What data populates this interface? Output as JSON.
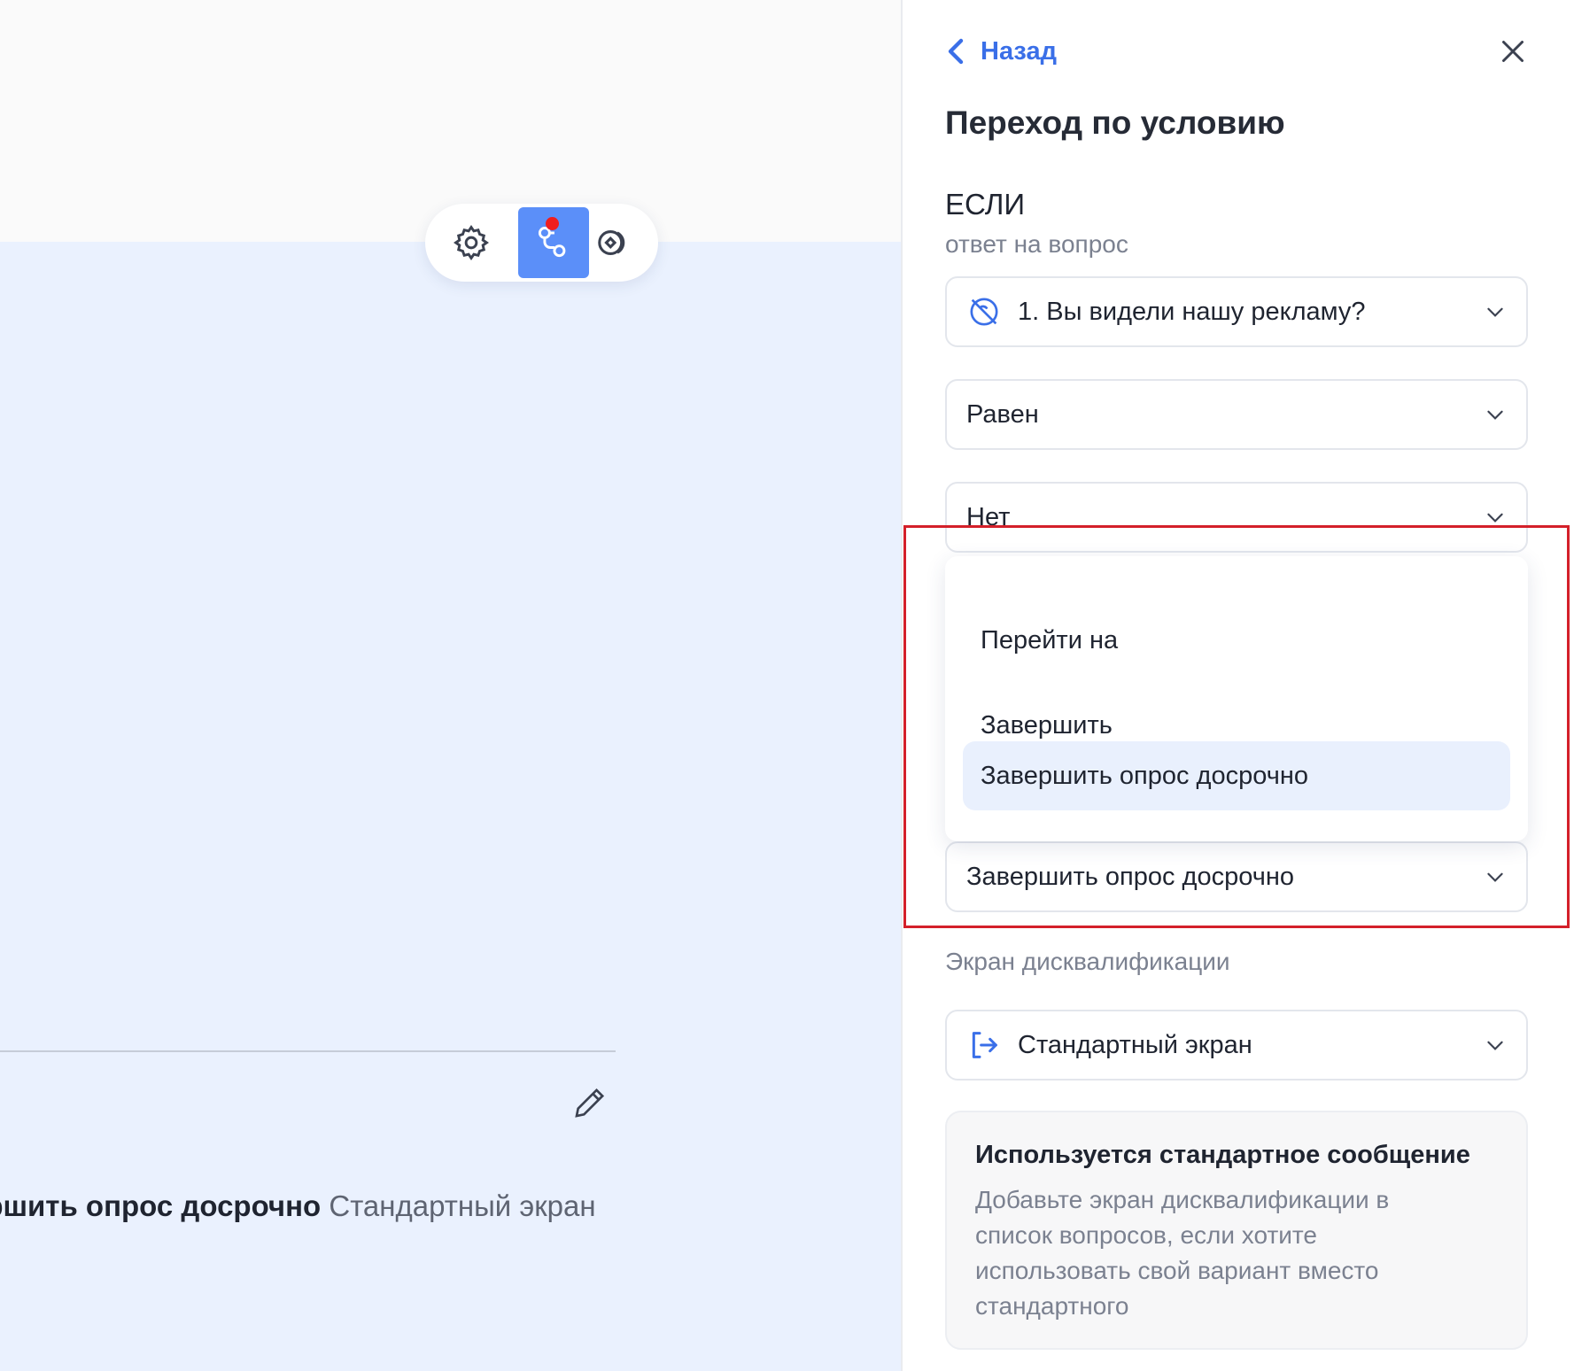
{
  "canvas": {
    "summary_bold": "ершить опрос досрочно",
    "summary_rest": "Стандартный экран"
  },
  "toolbar": {
    "buttons": [
      "gear-icon",
      "branch-icon",
      "eye-icon"
    ],
    "active": "branch-icon",
    "accent_color": "#5b8ff9",
    "badge_color": "#f01e1e"
  },
  "panel": {
    "back_label": "Назад",
    "title": "Переход по условию",
    "if_label": "ЕСЛИ",
    "if_sub": "ответ на вопрос",
    "question_select": "1. Вы видели нашу рекламу?",
    "operator_select": "Равен",
    "answer_select": "Нет",
    "action_menu": {
      "items": [
        "Перейти на",
        "Завершить",
        "Завершить опрос досрочно"
      ],
      "selected_index": 2
    },
    "action_select": "Завершить опрос досрочно",
    "disq_label": "Экран дисквалификации",
    "screen_select": "Стандартный экран",
    "note": {
      "title": "Используется стандартное сообщение",
      "body": "Добавьте экран дисквалификации в список вопросов, если хотите использовать свой вариант вместо стандартного"
    }
  },
  "colors": {
    "link": "#3a6fe8",
    "highlight_border": "#d4202a",
    "selected_item_bg": "#e9f0fd"
  }
}
